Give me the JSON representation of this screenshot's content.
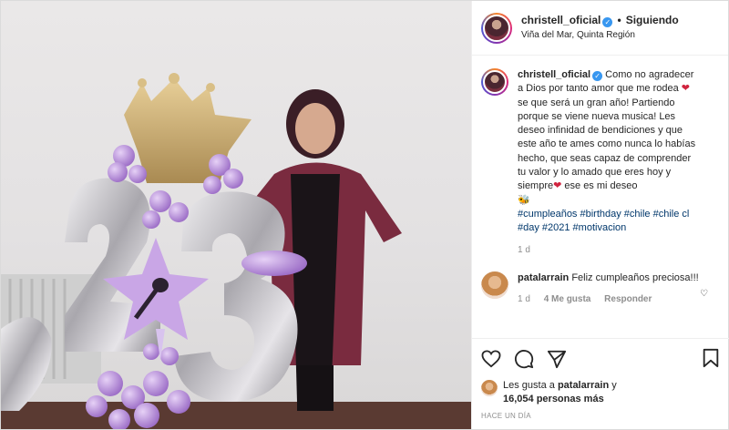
{
  "header": {
    "username": "christell_oficial",
    "follow_status": "Siguiendo",
    "location": "Viña del Mar, Quinta Región"
  },
  "caption": {
    "username": "christell_oficial",
    "text_1": "Como no agradecer a Dios por tanto amor que me rodea ",
    "emoji_1": "❤",
    "text_2": " se que será un gran año! Partiendo porque se viene nueva musica! Les deseo infinidad de bendiciones y que este año te ames como nunca lo habías hecho, que seas capaz de comprender tu valor y lo amado que eres hoy y siempre",
    "emoji_2": "❤",
    "text_3": " ese es mi deseo",
    "emoji_3": "🐝",
    "hashtags": "#cumpleaños #birthday #chile #chile cl #day #2021 #motivacion",
    "time": "1 d"
  },
  "comment": {
    "username": "patalarrain",
    "text": "Feliz cumpleaños preciosa!!!",
    "time": "1 d",
    "likes": "4 Me gusta",
    "reply": "Responder"
  },
  "likes": {
    "prefix": "Les gusta a ",
    "user": "patalarrain",
    "middle": " y ",
    "count": "16,054 personas más"
  },
  "post_time": "HACE UN DÍA",
  "colors": {
    "accent": "#3897f0",
    "hashtag": "#00376b",
    "heart": "#d0243f",
    "balloon_purple": "#b893d9",
    "balloon_silver": "#c7c5ca"
  }
}
